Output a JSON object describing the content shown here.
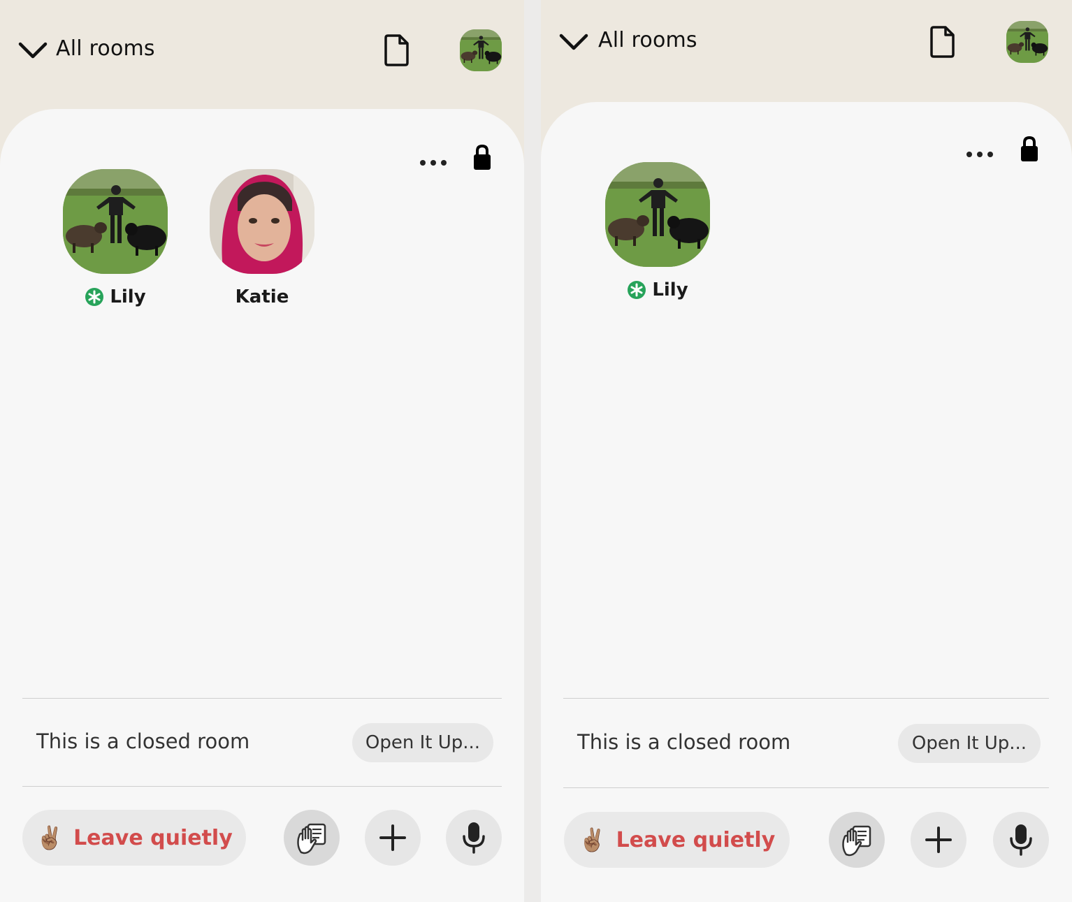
{
  "panels": [
    {
      "header": {
        "title": "All rooms",
        "chevron_icon": "chevron-down-icon",
        "doc_icon": "document-icon",
        "avatar_icon": "profile-avatar"
      },
      "speakers": [
        {
          "name": "Lily",
          "moderator_badge": true
        },
        {
          "name": "Katie",
          "moderator_badge": false
        }
      ],
      "closed_room_text": "This is a closed room",
      "open_button": "Open It Up...",
      "leave_button": {
        "emoji": "✌🏽",
        "label": "Leave quietly"
      },
      "actions": [
        "raise-hand-icon",
        "plus-icon",
        "microphone-icon"
      ]
    },
    {
      "header": {
        "title": "All rooms",
        "chevron_icon": "chevron-down-icon",
        "doc_icon": "document-icon",
        "avatar_icon": "profile-avatar"
      },
      "speakers": [
        {
          "name": "Lily",
          "moderator_badge": true
        }
      ],
      "closed_room_text": "This is a closed room",
      "open_button": "Open It Up...",
      "leave_button": {
        "emoji": "✌🏽",
        "label": "Leave quietly"
      },
      "actions": [
        "raise-hand-icon",
        "plus-icon",
        "microphone-icon"
      ]
    }
  ],
  "colors": {
    "header_bg": "#ede8df",
    "card_bg": "#f7f7f7",
    "leave_text": "#d24c4c",
    "badge_green": "#27a35a"
  }
}
